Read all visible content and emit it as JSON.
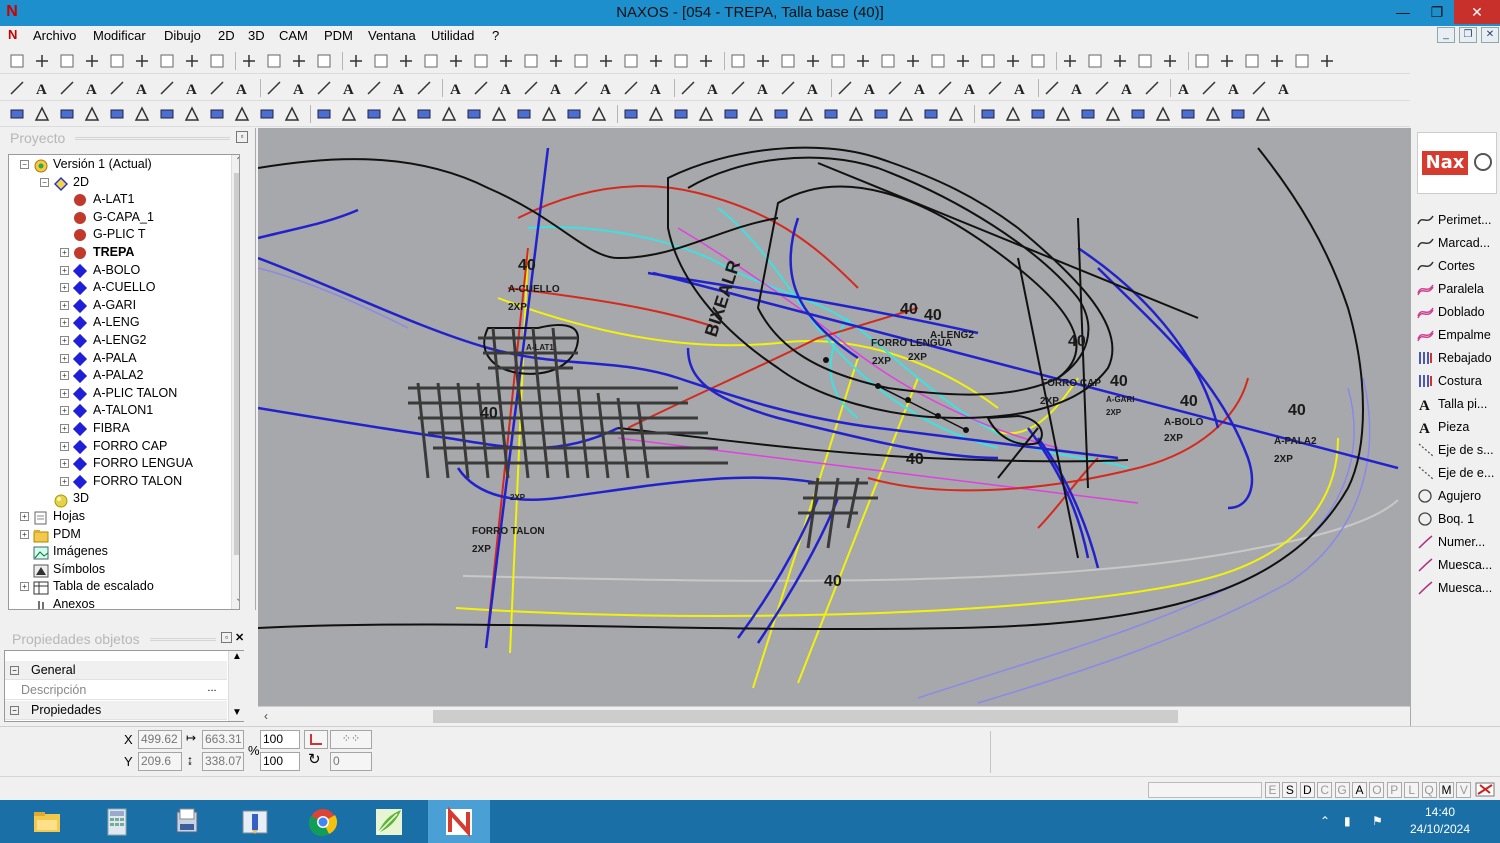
{
  "window": {
    "title": "NAXOS - [054 - TREPA, Talla base (40)]",
    "minimize": "—",
    "restore": "❐",
    "close": "✕"
  },
  "menu": [
    "Archivo",
    "Modificar",
    "Dibujo",
    "2D",
    "3D",
    "CAM",
    "PDM",
    "Ventana",
    "Utilidad",
    "?"
  ],
  "project_panel": {
    "title": "Proyecto",
    "tree": [
      {
        "label": "Versión 1 (Actual)",
        "icon": "version-icon",
        "level": 0,
        "expander": "−"
      },
      {
        "label": "2D",
        "icon": "diamond-2d-icon",
        "level": 1,
        "expander": "−"
      },
      {
        "label": "A-LAT1",
        "icon": "red-dot",
        "level": 2,
        "expander": ""
      },
      {
        "label": "G-CAPA_1",
        "icon": "red-dot",
        "level": 2,
        "expander": ""
      },
      {
        "label": "G-PLIC T",
        "icon": "red-dot",
        "level": 2,
        "expander": ""
      },
      {
        "label": "TREPA",
        "icon": "red-dot",
        "level": 2,
        "expander": "+",
        "bold": true
      },
      {
        "label": "A-BOLO",
        "icon": "blue-diamond",
        "level": 2,
        "expander": "+"
      },
      {
        "label": "A-CUELLO",
        "icon": "blue-diamond",
        "level": 2,
        "expander": "+"
      },
      {
        "label": "A-GARI",
        "icon": "blue-diamond",
        "level": 2,
        "expander": "+"
      },
      {
        "label": "A-LENG",
        "icon": "blue-diamond",
        "level": 2,
        "expander": "+"
      },
      {
        "label": "A-LENG2",
        "icon": "blue-diamond",
        "level": 2,
        "expander": "+"
      },
      {
        "label": "A-PALA",
        "icon": "blue-diamond",
        "level": 2,
        "expander": "+"
      },
      {
        "label": "A-PALA2",
        "icon": "blue-diamond",
        "level": 2,
        "expander": "+"
      },
      {
        "label": "A-PLIC TALON",
        "icon": "blue-diamond",
        "level": 2,
        "expander": "+"
      },
      {
        "label": "A-TALON1",
        "icon": "blue-diamond",
        "level": 2,
        "expander": "+"
      },
      {
        "label": "FIBRA",
        "icon": "blue-diamond",
        "level": 2,
        "expander": "+"
      },
      {
        "label": "FORRO CAP",
        "icon": "blue-diamond",
        "level": 2,
        "expander": "+"
      },
      {
        "label": "FORRO LENGUA",
        "icon": "blue-diamond",
        "level": 2,
        "expander": "+"
      },
      {
        "label": "FORRO TALON",
        "icon": "blue-diamond",
        "level": 2,
        "expander": "+"
      },
      {
        "label": "3D",
        "icon": "sphere-3d-icon",
        "level": 1,
        "expander": ""
      },
      {
        "label": "Hojas",
        "icon": "sheets-icon",
        "level": 0,
        "expander": "+"
      },
      {
        "label": "PDM",
        "icon": "folder-icon",
        "level": 0,
        "expander": "+"
      },
      {
        "label": "Imágenes",
        "icon": "images-icon",
        "level": 0,
        "expander": ""
      },
      {
        "label": "Símbolos",
        "icon": "symbols-icon",
        "level": 0,
        "expander": ""
      },
      {
        "label": "Tabla de escalado",
        "icon": "scale-table-icon",
        "level": 0,
        "expander": "+"
      },
      {
        "label": "Anexos",
        "icon": "attachments-icon",
        "level": 0,
        "expander": ""
      }
    ]
  },
  "properties_panel": {
    "title": "Propiedades objetos",
    "rows": [
      {
        "label": "General",
        "kind": "group",
        "expander": "−"
      },
      {
        "label": "Descripción",
        "kind": "field",
        "button": "..."
      },
      {
        "label": "Propiedades",
        "kind": "group",
        "expander": "−"
      }
    ]
  },
  "canvas": {
    "labels": [
      "40",
      "A-CUELLO",
      "2XP",
      "40",
      "40",
      "FORRO LENGUA",
      "A-LENG2",
      "2XP",
      "2XP",
      "BIXEALR",
      "40",
      "FORRO CAP",
      "2XP",
      "40",
      "A-GARI",
      "2XP",
      "40",
      "A-BOLO",
      "2XP",
      "40",
      "A-PALA2",
      "2XP",
      "40",
      "FORRO TALON",
      "2XP",
      "40",
      "40",
      "A-LAT1",
      "2XP"
    ]
  },
  "palette": {
    "logo_text": "Nax",
    "items": [
      {
        "label": "Perimet...",
        "icon": "perimeter-icon"
      },
      {
        "label": "Marcad...",
        "icon": "marker-icon"
      },
      {
        "label": "Cortes",
        "icon": "cuts-icon"
      },
      {
        "label": "Paralela",
        "icon": "parallel-icon"
      },
      {
        "label": "Doblado",
        "icon": "fold-icon"
      },
      {
        "label": "Empalme",
        "icon": "splice-icon"
      },
      {
        "label": "Rebajado",
        "icon": "skive-icon"
      },
      {
        "label": "Costura",
        "icon": "seam-icon"
      },
      {
        "label": "Talla pi...",
        "icon": "size-text-icon"
      },
      {
        "label": "Pieza",
        "icon": "piece-text-icon"
      },
      {
        "label": "Eje de s...",
        "icon": "axis-icon"
      },
      {
        "label": "Eje de e...",
        "icon": "axis2-icon"
      },
      {
        "label": "Agujero",
        "icon": "hole-icon"
      },
      {
        "label": "Boq. 1",
        "icon": "nozzle-icon"
      },
      {
        "label": "Numer...",
        "icon": "number-icon"
      },
      {
        "label": "Muesca...",
        "icon": "notch-icon"
      },
      {
        "label": "Muesca...",
        "icon": "notch2-icon"
      }
    ]
  },
  "coords": {
    "x_label": "X",
    "y_label": "Y",
    "x": "499.62",
    "y": "209.6",
    "width": "663.31",
    "height": "338.07",
    "scale_x": "100",
    "scale_y": "100",
    "percent": "%",
    "rotation": "0"
  },
  "status_keys": [
    {
      "key": "E",
      "on": false
    },
    {
      "key": "S",
      "on": true
    },
    {
      "key": "D",
      "on": true
    },
    {
      "key": "C",
      "on": false
    },
    {
      "key": "G",
      "on": false
    },
    {
      "key": "A",
      "on": true
    },
    {
      "key": "O",
      "on": false
    },
    {
      "key": "P",
      "on": false
    },
    {
      "key": "L",
      "on": false
    },
    {
      "key": "Q",
      "on": false
    },
    {
      "key": "M",
      "on": true
    },
    {
      "key": "V",
      "on": false
    }
  ],
  "taskbar": {
    "apps": [
      "file-explorer-icon",
      "calculator-icon",
      "documents-icon",
      "pencil-app-icon",
      "chrome-icon",
      "leaf-app-icon",
      "naxos-icon"
    ],
    "time": "14:40",
    "date": "24/10/2024"
  },
  "colors": {
    "canvas_bg": "#a7a8ab",
    "titlebar": "#1d8fcc",
    "taskbar": "#1a6fa6",
    "line_black": "#111111",
    "line_blue": "#2222cc",
    "line_red": "#d42a1e",
    "line_cyan": "#3fe0e0",
    "line_yellow": "#f2f20a",
    "line_magenta": "#e040e0",
    "line_lilac": "#8c88e8"
  }
}
